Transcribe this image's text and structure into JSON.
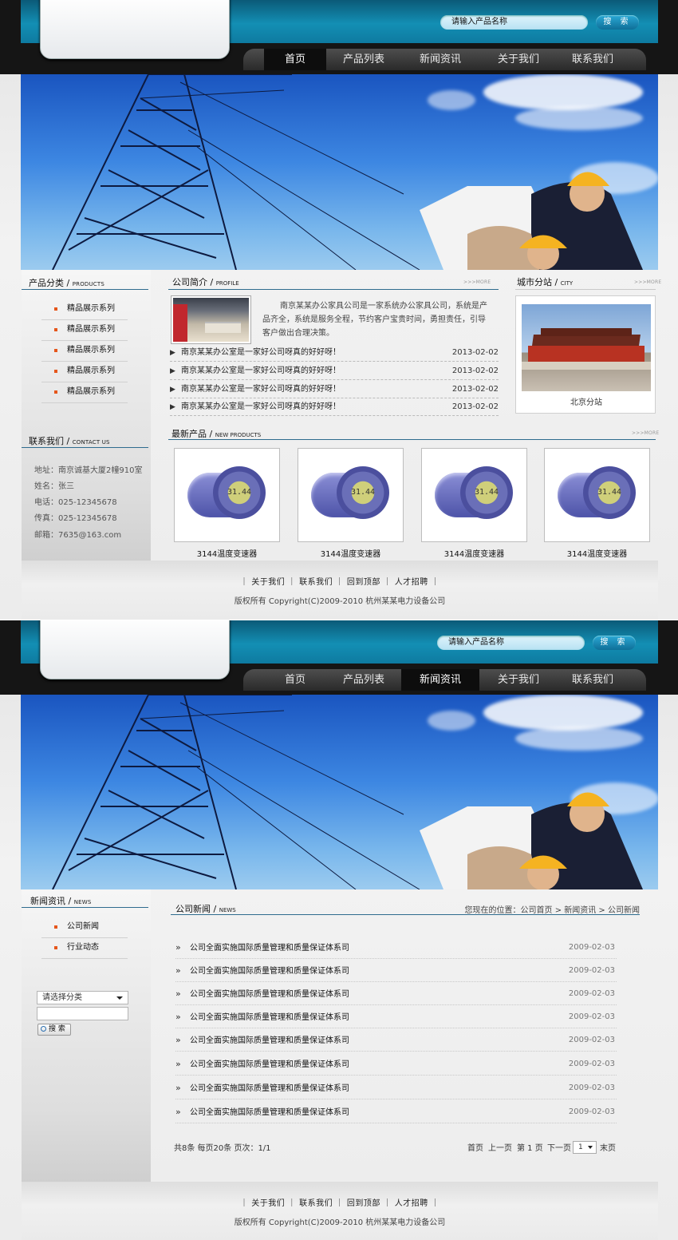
{
  "search": {
    "placeholder": "请输入产品名称",
    "button": "搜 索"
  },
  "nav": [
    "首页",
    "产品列表",
    "新闻资讯",
    "关于我们",
    "联系我们"
  ],
  "home": {
    "product_cat": {
      "title": "产品分类",
      "sub": "PRODUCTS",
      "items": [
        "精品展示系列",
        "精品展示系列",
        "精品展示系列",
        "精品展示系列",
        "精品展示系列"
      ]
    },
    "contact": {
      "title": "联系我们",
      "sub": "CONTACT US",
      "lines": [
        "地址：南京诚基大厦2幢910室",
        "姓名：张三",
        "电话：025-12345678",
        "传真：025-12345678",
        "邮箱：7635@163.com"
      ]
    },
    "profile": {
      "title": "公司简介",
      "sub": "PROFILE",
      "more": ">>>MORE",
      "text": "南京某某办公家具公司是一家系统办公家具公司，系统是产品齐全，系统是服务全程，节约客户宝贵时间，勇担责任，引导客户做出合理决策。"
    },
    "news": [
      {
        "title": "南京某某办公室是一家好公司呀真的好好呀！",
        "date": "2013-02-02"
      },
      {
        "title": "南京某某办公室是一家好公司呀真的好好呀！",
        "date": "2013-02-02"
      },
      {
        "title": "南京某某办公室是一家好公司呀真的好好呀！",
        "date": "2013-02-02"
      },
      {
        "title": "南京某某办公室是一家好公司呀真的好好呀！",
        "date": "2013-02-02"
      }
    ],
    "city": {
      "title": "城市分站",
      "sub": "CITY",
      "more": ">>>MORE",
      "caption": "北京分站"
    },
    "new_products": {
      "title": "最新产品",
      "sub": "NEW PRODUCTS",
      "more": ">>>MORE",
      "items": [
        "3144温度变速器",
        "3144温度变速器",
        "3144温度变速器",
        "3144温度变速器"
      ]
    }
  },
  "footer": {
    "links": "｜ 关于我们 ｜ 联系我们 ｜ 回到顶部 ｜ 人才招聘 ｜",
    "copyright": "版权所有 Copyright(C)2009-2010 杭州某某电力设备公司"
  },
  "newspage": {
    "side": {
      "title": "新闻资讯",
      "sub": "NEWS",
      "items": [
        "公司新闻",
        "行业动态"
      ],
      "select": "请选择分类",
      "button": "搜 索"
    },
    "title": "公司新闻",
    "sub": "NEWS",
    "crumb": "您现在的位置：公司首页 > 新闻资讯 > 公司新闻",
    "rows": [
      {
        "title": "公司全面实施国际质量管理和质量保证体系司",
        "date": "2009-02-03"
      },
      {
        "title": "公司全面实施国际质量管理和质量保证体系司",
        "date": "2009-02-03"
      },
      {
        "title": "公司全面实施国际质量管理和质量保证体系司",
        "date": "2009-02-03"
      },
      {
        "title": "公司全面实施国际质量管理和质量保证体系司",
        "date": "2009-02-03"
      },
      {
        "title": "公司全面实施国际质量管理和质量保证体系司",
        "date": "2009-02-03"
      },
      {
        "title": "公司全面实施国际质量管理和质量保证体系司",
        "date": "2009-02-03"
      },
      {
        "title": "公司全面实施国际质量管理和质量保证体系司",
        "date": "2009-02-03"
      },
      {
        "title": "公司全面实施国际质量管理和质量保证体系司",
        "date": "2009-02-03"
      }
    ],
    "pager_info": "共8条 每页20条 页次：1/1",
    "pager": {
      "first": "首页",
      "prev": "上一页",
      "page": "第 1 页",
      "next": "下一页",
      "sel": "1",
      "last": "末页"
    }
  },
  "icons": [
    "arrow-right-icon",
    "double-chevron-icon",
    "magnifier-icon",
    "dropdown-arrow-icon"
  ],
  "colors": {
    "brand_blue": "#138fb4",
    "nav_dark": "#2a2a2a",
    "bullet": "#e5561b",
    "rule": "#2f6c8e"
  }
}
